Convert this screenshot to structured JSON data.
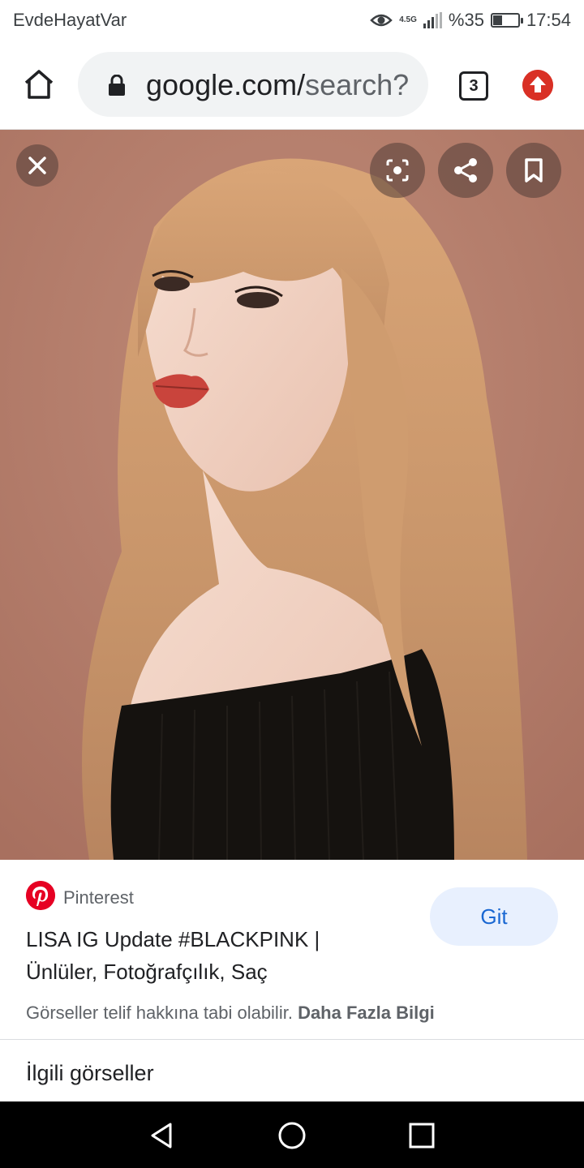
{
  "status_bar": {
    "carrier": "EvdeHayatVar",
    "network": "4.5G",
    "battery_text": "%35",
    "battery_level": 0.35,
    "time": "17:54"
  },
  "address_bar": {
    "url_main": "google.com/",
    "url_rest": "search?",
    "tab_count": "3"
  },
  "viewer": {
    "image_icon": "photo-of-woman",
    "buttons": {
      "close": "close-icon",
      "lens": "lens-icon",
      "share": "share-icon",
      "save": "bookmark-icon"
    }
  },
  "result": {
    "source": "Pinterest",
    "title": "LISA IG Update #BLACKPINK | Ünlüler, Fotoğrafçılık, Saç",
    "visit_label": "Git",
    "copyright_text": "Görseller telif hakkına tabi olabilir.",
    "more_info_link": "Daha Fazla Bilgi"
  },
  "related": {
    "title": "İlgili görseller"
  },
  "colors": {
    "backdrop": "#b67e6c",
    "pinterest_red": "#e60023",
    "update_red": "#d93025",
    "visit_button_bg": "#e8f0fe",
    "visit_button_text": "#1967d2"
  }
}
